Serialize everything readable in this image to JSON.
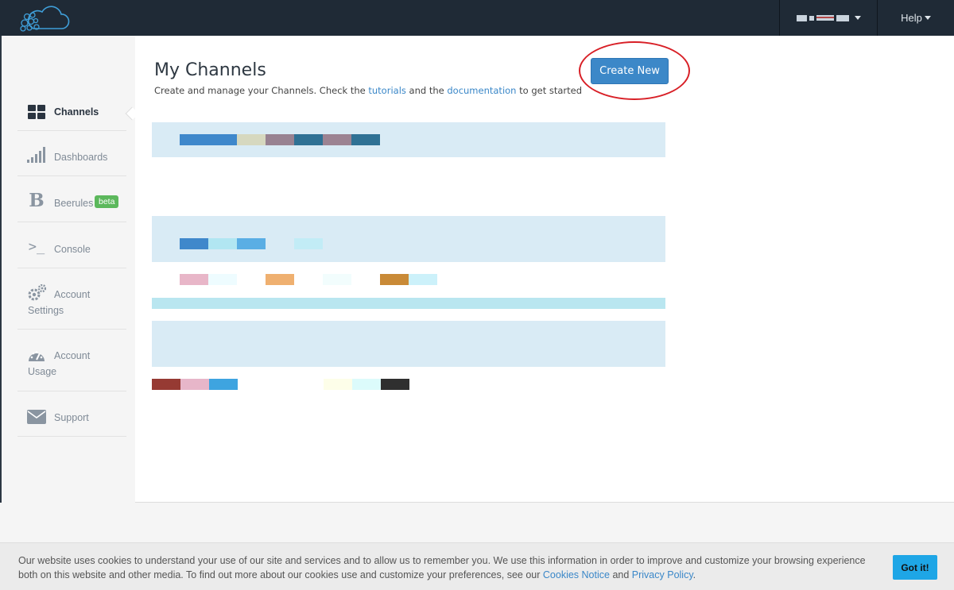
{
  "topbar": {
    "logo_icon": "cloud-bees-logo-icon",
    "language_icon": "flag-icon",
    "help_label": "Help"
  },
  "sidebar": {
    "items": [
      {
        "id": "channels",
        "label": "Channels",
        "icon": "grid-icon"
      },
      {
        "id": "dashboards",
        "label": "Dashboards",
        "icon": "signal-bars-icon"
      },
      {
        "id": "beerules",
        "label": "Beerules",
        "icon": "bold-b-icon",
        "badge": "beta"
      },
      {
        "id": "console",
        "label": "Console",
        "icon": "terminal-icon"
      },
      {
        "id": "account-settings",
        "label_line1": "Account",
        "label_line2": "Settings",
        "icon": "gears-icon"
      },
      {
        "id": "account-usage",
        "label_line1": "Account",
        "label_line2": "Usage",
        "icon": "gauge-icon"
      },
      {
        "id": "support",
        "label": "Support",
        "icon": "envelope-icon"
      }
    ]
  },
  "main": {
    "title": "My Channels",
    "subtitle_pre": "Create and manage your Channels. Check the ",
    "subtitle_link1": "tutorials",
    "subtitle_mid": " and the ",
    "subtitle_link2": "documentation",
    "subtitle_post": " to get started",
    "create_button": "Create New"
  },
  "colors": {
    "topbar": "#1f2a36",
    "accent": "#3c88c8",
    "row_band": "#d9ebf5",
    "highlight": "#d81f26",
    "badge": "#5cb85c"
  },
  "cookie": {
    "text_part1": "Our website uses cookies to understand your use of our site and services and to allow us to remember you. We use this information in order to improve and customize your browsing experience both on this website and other media. To find out more about our cookies use and customize your preferences, see our ",
    "link1": "Cookies Notice",
    "text_part2": " and ",
    "link2": "Privacy Policy",
    "text_part3": ".",
    "button": "Got it!"
  }
}
